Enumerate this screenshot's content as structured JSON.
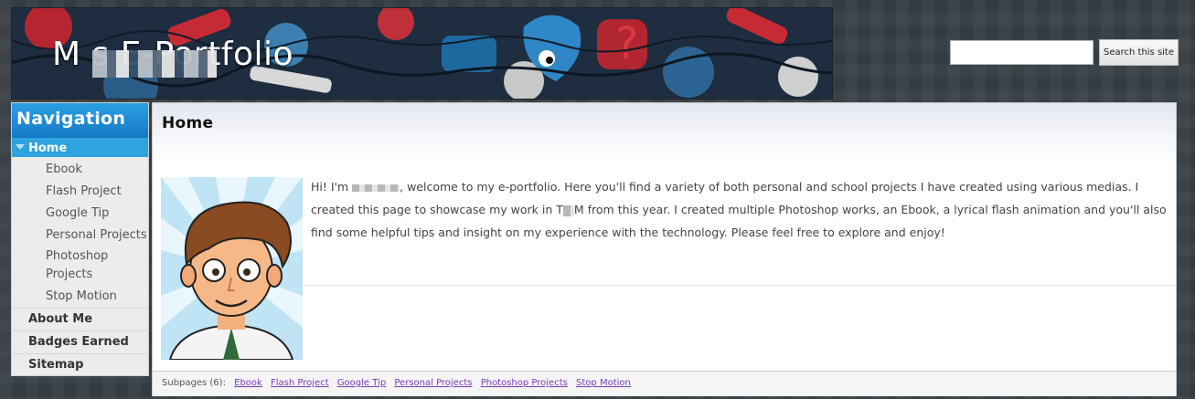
{
  "site": {
    "title": "M       s E-Portfolio"
  },
  "search": {
    "placeholder": "",
    "button_label": "Search this site"
  },
  "navigation": {
    "header": "Navigation",
    "active": "Home",
    "subitems": [
      "Ebook",
      "Flash Project",
      "Google Tip",
      "Personal Projects",
      "Photoshop Projects",
      "Stop Motion"
    ],
    "top_items": [
      "About Me",
      "Badges Earned",
      "Sitemap"
    ]
  },
  "page": {
    "title": "Home",
    "intro_part1": "Hi! I'm ",
    "intro_part2": ", welcome to my e-portfolio. Here you'll find a variety of both personal and school projects I have created using various medias. I created this page to showcase my work in T",
    "intro_part3": "M from this year. I created multiple Photoshop works, an Ebook, a lyrical flash animation and you'll also find some helpful tips and insight on my experience with the technology.    Please feel free to explore and enjoy!"
  },
  "subpages": {
    "label": "Subpages (6):",
    "links": [
      "Ebook",
      "Flash Project",
      "Google Tip",
      "Personal Projects",
      "Photoshop Projects",
      "Stop Motion"
    ]
  },
  "colors": {
    "nav_header": "#1679c4",
    "nav_active": "#2ea3df",
    "link": "#7a3bb8",
    "background": "#3a4147"
  }
}
